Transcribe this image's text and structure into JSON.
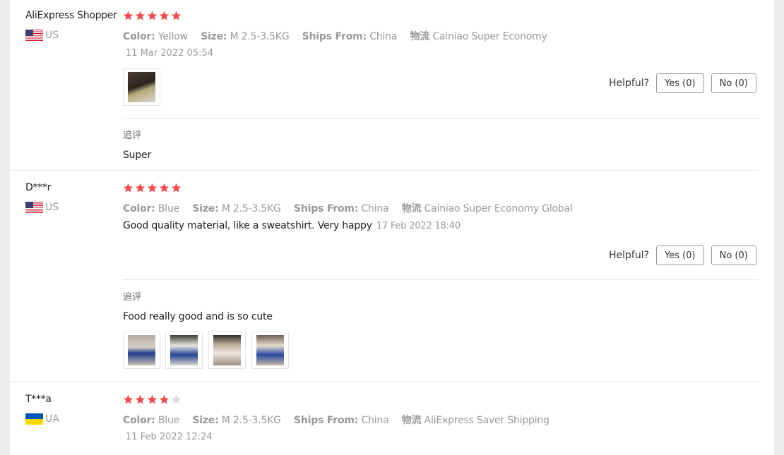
{
  "reviews": [
    {
      "user": "AliExpress Shopper",
      "country": "US",
      "rating": 5,
      "color_label": "Color:",
      "color": "Yellow",
      "size_label": "Size:",
      "size": "M 2.5-3.5KG",
      "ships_label": "Ships From:",
      "ships": "China",
      "logistics_label": "物流",
      "logistics": "Cainiao Super Economy",
      "date": "11 Mar 2022 05:54",
      "helpful": "Helpful?",
      "yes": "Yes (0)",
      "no": "No (0)",
      "followup_label": "追评",
      "followup_text": "Super"
    },
    {
      "user": "D***r",
      "country": "US",
      "rating": 5,
      "color_label": "Color:",
      "color": "Blue",
      "size_label": "Size:",
      "size": "M 2.5-3.5KG",
      "ships_label": "Ships From:",
      "ships": "China",
      "logistics_label": "物流",
      "logistics": "Cainiao Super Economy Global",
      "text": "Good quality material, like a sweatshirt. Very happy",
      "date": "17 Feb 2022 18:40",
      "helpful": "Helpful?",
      "yes": "Yes (0)",
      "no": "No (0)",
      "followup_label": "追评",
      "followup_text": "Food really good and is so cute"
    },
    {
      "user": "T***a",
      "country": "UA",
      "rating": 4,
      "color_label": "Color:",
      "color": "Blue",
      "size_label": "Size:",
      "size": "M 2.5-3.5KG",
      "ships_label": "Ships From:",
      "ships": "China",
      "logistics_label": "物流",
      "logistics": "AliExpress Saver Shipping",
      "date": "11 Feb 2022 12:24"
    }
  ],
  "colors": {
    "star": "#f04e4e",
    "star_empty": "#d9d9d9"
  }
}
